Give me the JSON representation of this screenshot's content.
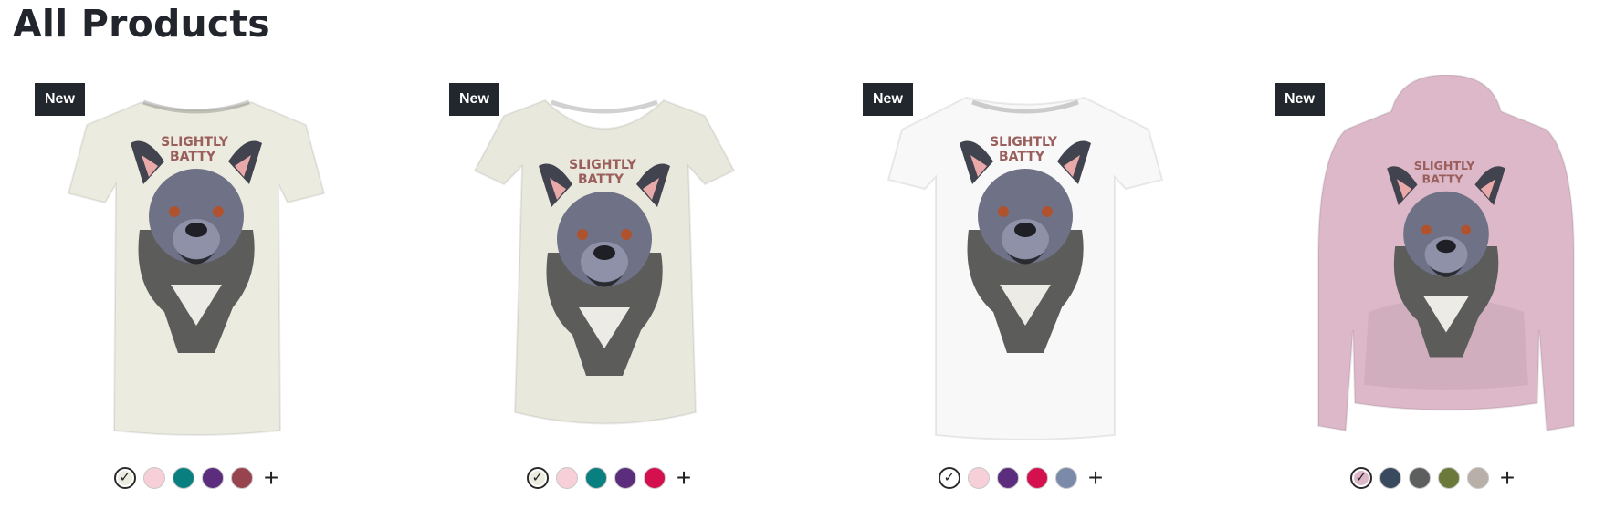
{
  "page": {
    "title": "All Products"
  },
  "products": [
    {
      "badge": "New",
      "garment": "tshirt",
      "garment_color": "#ecebdf",
      "design_text": "SLIGHTLY BATTY",
      "swatches": [
        "#ecebdf",
        "#f7cfd8",
        "#0a7f80",
        "#5b2d7c",
        "#97444f"
      ],
      "selected_swatch": 0,
      "more_label": "+"
    },
    {
      "badge": "New",
      "garment": "womens-tshirt",
      "garment_color": "#e9e8dc",
      "design_text": "SLIGHTLY BATTY",
      "swatches": [
        "#ecebdf",
        "#f7cfd8",
        "#0a7f80",
        "#5b2d7c",
        "#d5104f"
      ],
      "selected_swatch": 0,
      "more_label": "+"
    },
    {
      "badge": "New",
      "garment": "kids-tshirt",
      "garment_color": "#f8f8f8",
      "design_text": "SLIGHTLY BATTY",
      "swatches": [
        "#ffffff",
        "#f7cfd8",
        "#5b2d7c",
        "#d5104f",
        "#7a8aa8"
      ],
      "selected_swatch": 0,
      "more_label": "+"
    },
    {
      "badge": "New",
      "garment": "hoodie",
      "garment_color": "#dcb8c8",
      "design_text": "SLIGHTLY BATTY",
      "swatches": [
        "#dcb8c8",
        "#3a4a5e",
        "#5d5e5e",
        "#6b7a3a",
        "#b8afa8"
      ],
      "selected_swatch": 0,
      "more_label": "+"
    }
  ]
}
